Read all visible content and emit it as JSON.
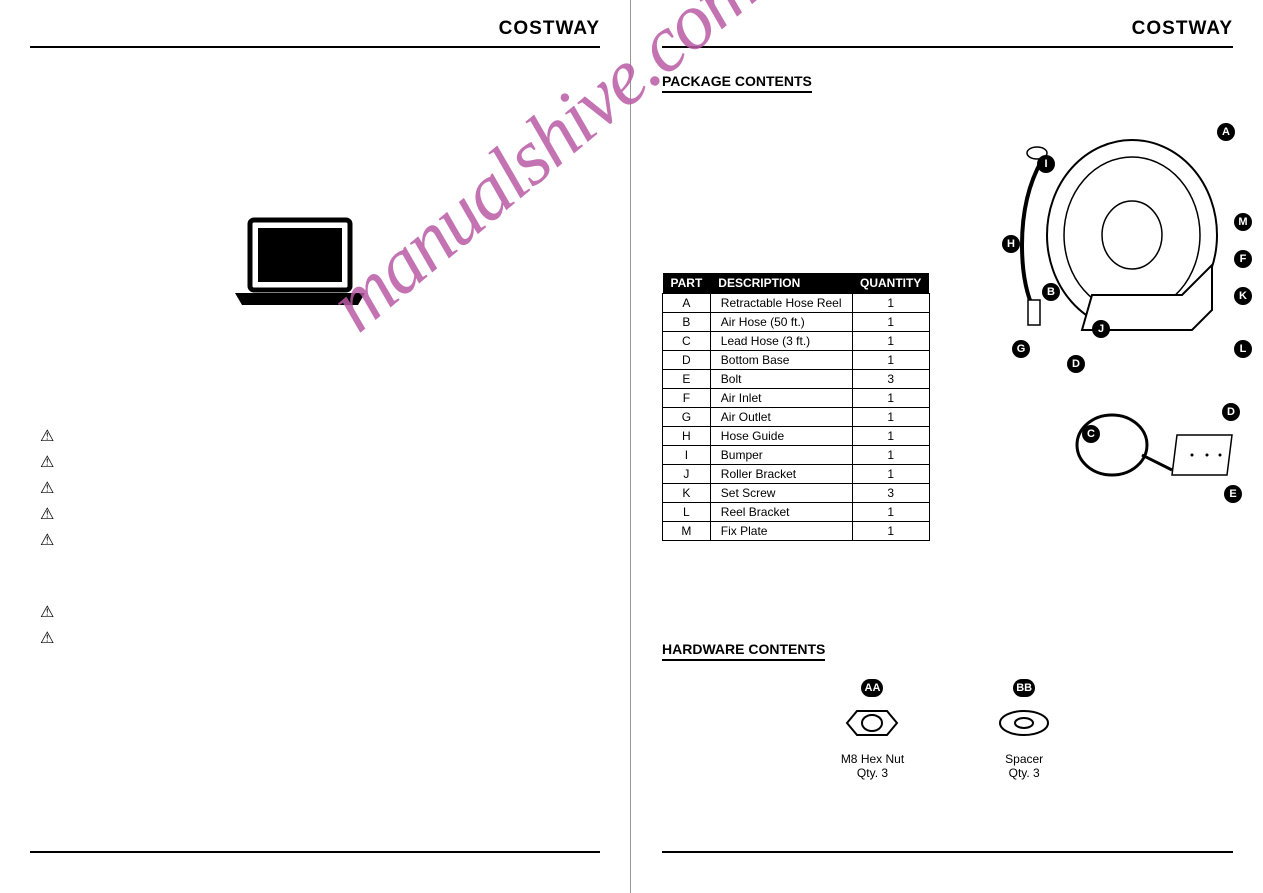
{
  "brand": "COSTWAY",
  "watermark": "manualshive.com",
  "sections": {
    "package": "PACKAGE CONTENTS",
    "hardware": "HARDWARE CONTENTS"
  },
  "parts_table": {
    "headers": [
      "PART",
      "DESCRIPTION",
      "QUANTITY"
    ],
    "rows": [
      [
        "A",
        "Retractable Hose Reel",
        "1"
      ],
      [
        "B",
        "Air Hose (50 ft.)",
        "1"
      ],
      [
        "C",
        "Lead Hose (3 ft.)",
        "1"
      ],
      [
        "D",
        "Bottom Base",
        "1"
      ],
      [
        "E",
        "Bolt",
        "3"
      ],
      [
        "F",
        "Air Inlet",
        "1"
      ],
      [
        "G",
        "Air Outlet",
        "1"
      ],
      [
        "H",
        "Hose Guide",
        "1"
      ],
      [
        "I",
        "Bumper",
        "1"
      ],
      [
        "J",
        "Roller Bracket",
        "1"
      ],
      [
        "K",
        "Set Screw",
        "3"
      ],
      [
        "L",
        "Reel Bracket",
        "1"
      ],
      [
        "M",
        "Fix Plate",
        "1"
      ]
    ]
  },
  "callouts": [
    "A",
    "B",
    "C",
    "D",
    "E",
    "F",
    "G",
    "H",
    "I",
    "J",
    "K",
    "L",
    "M"
  ],
  "hardware": [
    {
      "code": "AA",
      "name": "M8 Hex Nut",
      "qty": "Qty. 3"
    },
    {
      "code": "BB",
      "name": "Spacer",
      "qty": "Qty. 3"
    }
  ]
}
